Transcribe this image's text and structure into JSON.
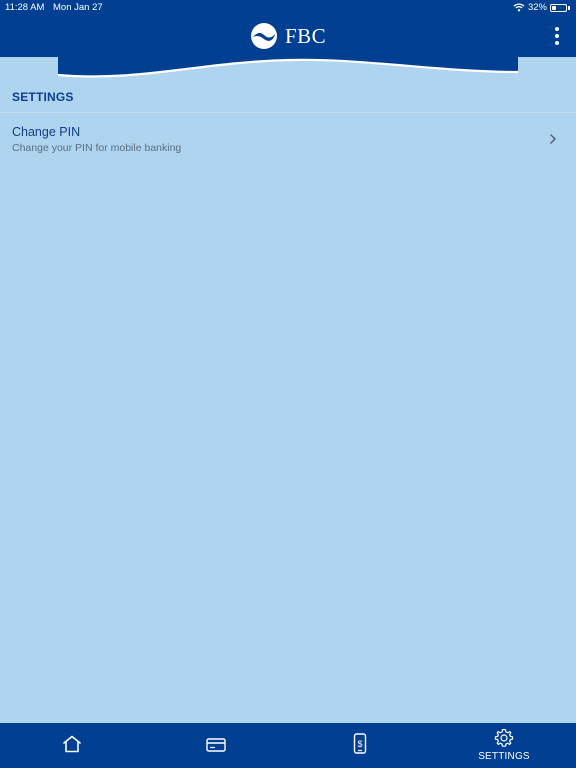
{
  "status_bar": {
    "time": "11:28 AM",
    "date": "Mon Jan 27",
    "battery": "32%",
    "battery_level": 0.32
  },
  "header": {
    "brand": "FBC",
    "menu_icon": "kebab-menu-icon"
  },
  "settings": {
    "section_title": "SETTINGS",
    "items": [
      {
        "title": "Change PIN",
        "subtitle": "Change your PIN for mobile banking",
        "icon": "chevron-right-icon"
      }
    ]
  },
  "bottom_nav": {
    "items": [
      {
        "icon": "home-icon",
        "label": ""
      },
      {
        "icon": "card-icon",
        "label": ""
      },
      {
        "icon": "mobile-payment-icon",
        "label": ""
      },
      {
        "icon": "gear-icon",
        "label": "SETTINGS"
      }
    ]
  },
  "colors": {
    "primary": "#003f91",
    "background": "#aed4ef",
    "section_title": "#0b3f8c"
  }
}
